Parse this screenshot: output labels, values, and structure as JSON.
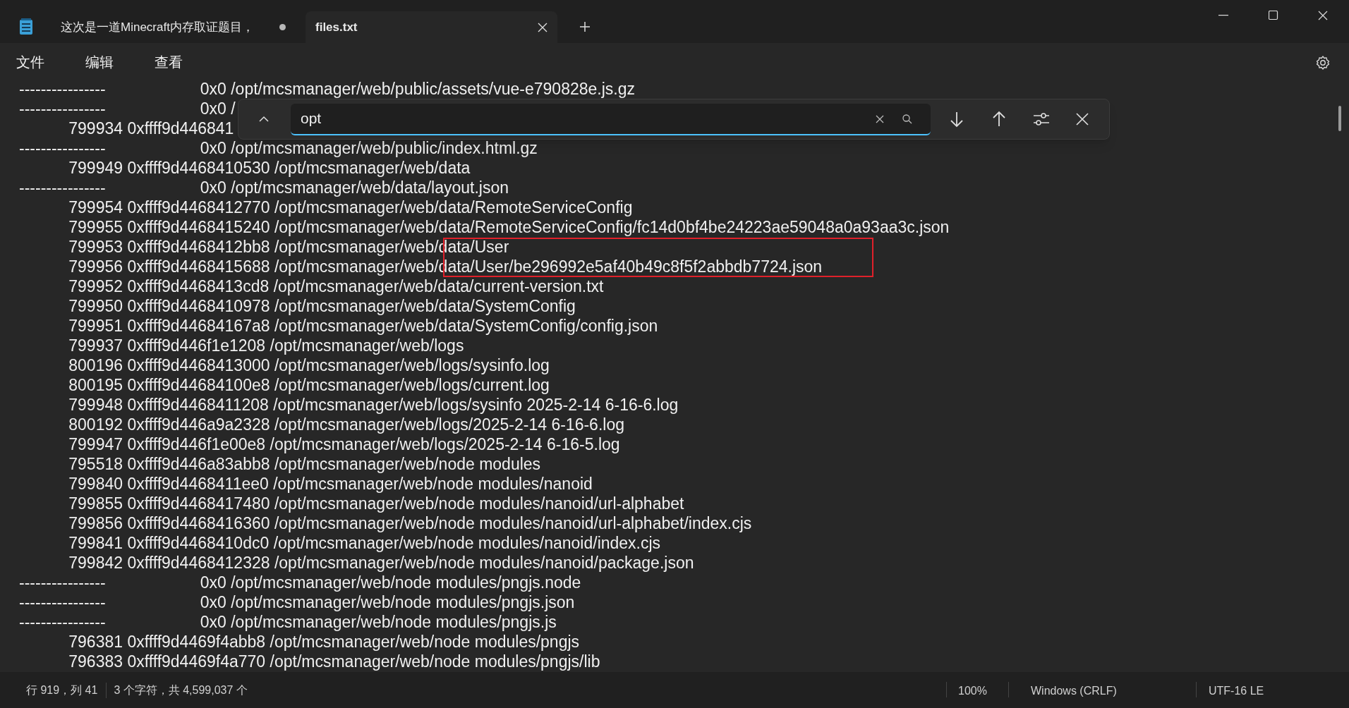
{
  "window": {
    "tabs": [
      {
        "title": "这次是一道Minecraft内存取证题目，",
        "modified": true,
        "selected": false
      },
      {
        "title": "files.txt",
        "modified": false,
        "selected": true
      }
    ]
  },
  "menu": [
    "文件",
    "编辑",
    "查看"
  ],
  "find_bar": {
    "value": "opt"
  },
  "lines": [
    "----------------                     0x0 /opt/mcsmanager/web/public/assets/vue-e790828e.js.gz",
    "----------------                     0x0 /",
    "           799934 0xffff9d446841",
    "----------------                     0x0 /opt/mcsmanager/web/public/index.html.gz",
    "           799949 0xffff9d4468410530 /opt/mcsmanager/web/data",
    "----------------                     0x0 /opt/mcsmanager/web/data/layout.json",
    "           799954 0xffff9d4468412770 /opt/mcsmanager/web/data/RemoteServiceConfig",
    "           799955 0xffff9d4468415240 /opt/mcsmanager/web/data/RemoteServiceConfig/fc14d0bf4be24223ae59048a0a93aa3c.json",
    "           799953 0xffff9d4468412bb8 /opt/mcsmanager/web/data/User",
    "           799956 0xffff9d4468415688 /opt/mcsmanager/web/data/User/be296992e5af40b49c8f5f2abbdb7724.json",
    "           799952 0xffff9d4468413cd8 /opt/mcsmanager/web/data/current-version.txt",
    "           799950 0xffff9d4468410978 /opt/mcsmanager/web/data/SystemConfig",
    "           799951 0xffff9d44684167a8 /opt/mcsmanager/web/data/SystemConfig/config.json",
    "           799937 0xffff9d446f1e1208 /opt/mcsmanager/web/logs",
    "           800196 0xffff9d4468413000 /opt/mcsmanager/web/logs/sysinfo.log",
    "           800195 0xffff9d44684100e8 /opt/mcsmanager/web/logs/current.log",
    "           799948 0xffff9d4468411208 /opt/mcsmanager/web/logs/sysinfo 2025-2-14 6-16-6.log",
    "           800192 0xffff9d446a9a2328 /opt/mcsmanager/web/logs/2025-2-14 6-16-6.log",
    "           799947 0xffff9d446f1e00e8 /opt/mcsmanager/web/logs/2025-2-14 6-16-5.log",
    "           795518 0xffff9d446a83abb8 /opt/mcsmanager/web/node modules",
    "           799840 0xffff9d4468411ee0 /opt/mcsmanager/web/node modules/nanoid",
    "           799855 0xffff9d4468417480 /opt/mcsmanager/web/node modules/nanoid/url-alphabet",
    "           799856 0xffff9d4468416360 /opt/mcsmanager/web/node modules/nanoid/url-alphabet/index.cjs",
    "           799841 0xffff9d4468410dc0 /opt/mcsmanager/web/node modules/nanoid/index.cjs",
    "           799842 0xffff9d4468412328 /opt/mcsmanager/web/node modules/nanoid/package.json",
    "----------------                     0x0 /opt/mcsmanager/web/node modules/pngjs.node",
    "----------------                     0x0 /opt/mcsmanager/web/node modules/pngjs.json",
    "----------------                     0x0 /opt/mcsmanager/web/node modules/pngjs.js",
    "           796381 0xffff9d4469f4abb8 /opt/mcsmanager/web/node modules/pngjs",
    "           796383 0xffff9d4469f4a770 /opt/mcsmanager/web/node modules/pngjs/lib"
  ],
  "status_bar": {
    "position": "行 919，列 41",
    "selection": "3 个字符，共 4,599,037 个",
    "zoom": "100%",
    "line_ending": "Windows (CRLF)",
    "encoding": "UTF-16 LE"
  }
}
